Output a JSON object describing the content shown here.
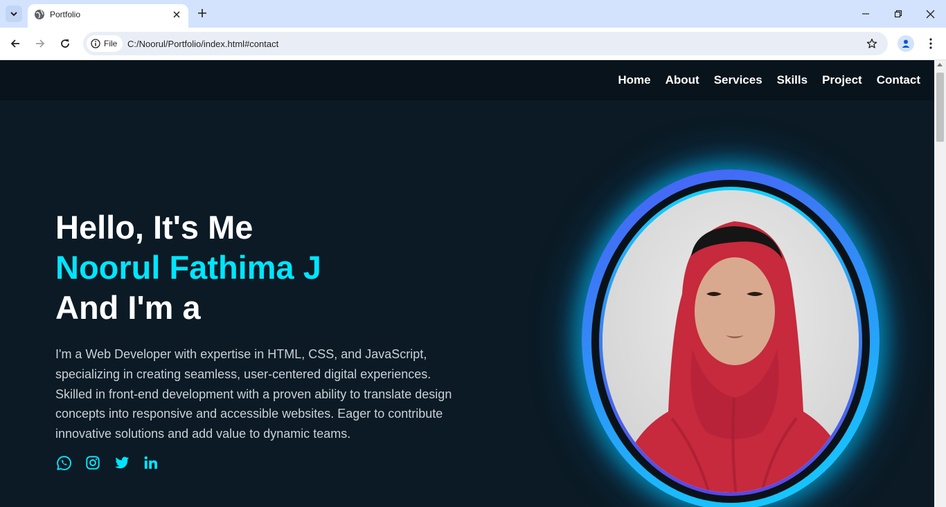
{
  "browser": {
    "tab_title": "Portfolio",
    "site_chip": "File",
    "url": "C:/Noorul/Portfolio/index.html#contact"
  },
  "nav": {
    "items": [
      {
        "label": "Home"
      },
      {
        "label": "About"
      },
      {
        "label": "Services"
      },
      {
        "label": "Skills"
      },
      {
        "label": "Project"
      },
      {
        "label": "Contact"
      }
    ]
  },
  "hero": {
    "greeting": "Hello, It's Me",
    "name": "Noorul Fathima J",
    "role_prefix": "And I'm a",
    "bio": "I'm a Web Developer with expertise in HTML, CSS, and JavaScript, specializing in creating seamless, user-centered digital experiences. Skilled in front-end development with a proven ability to translate design concepts into responsive and accessible websites. Eager to contribute innovative solutions and add value to dynamic teams."
  },
  "socials": [
    {
      "icon": "whatsapp-icon"
    },
    {
      "icon": "instagram-icon"
    },
    {
      "icon": "twitter-icon"
    },
    {
      "icon": "linkedin-icon"
    }
  ],
  "colors": {
    "accent": "#00e5ff",
    "background": "#0b1a24",
    "header": "#08131b"
  }
}
